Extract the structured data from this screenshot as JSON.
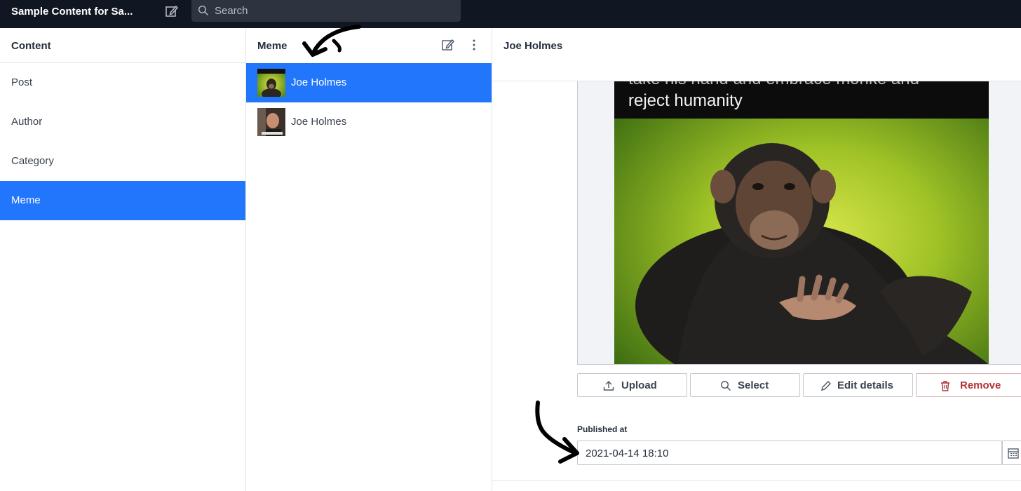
{
  "topbar": {
    "app_title": "Sample Content for Sa...",
    "search_placeholder": "Search"
  },
  "content_pane": {
    "title": "Content",
    "items": [
      {
        "label": "Post"
      },
      {
        "label": "Author"
      },
      {
        "label": "Category"
      },
      {
        "label": "Meme",
        "active": true
      }
    ]
  },
  "meme_pane": {
    "title": "Meme",
    "documents": [
      {
        "label": "Joe Holmes",
        "active": true
      },
      {
        "label": "Joe Holmes"
      }
    ]
  },
  "document": {
    "title": "Joe Holmes",
    "image_caption_top": "take his hand and embrace monke and",
    "image_caption": "reject humanity",
    "buttons": {
      "upload": "Upload",
      "select": "Select",
      "edit_details": "Edit details",
      "remove": "Remove"
    },
    "published_label": "Published at",
    "published_value": "2021-04-14 18:10"
  },
  "colors": {
    "accent": "#2276fc",
    "topbar": "#101722",
    "remove": "#b13237"
  },
  "icons": [
    "compose-icon",
    "search-icon",
    "more-vertical-icon",
    "upload-icon",
    "search-icon",
    "pencil-icon",
    "trash-icon",
    "calendar-icon"
  ]
}
